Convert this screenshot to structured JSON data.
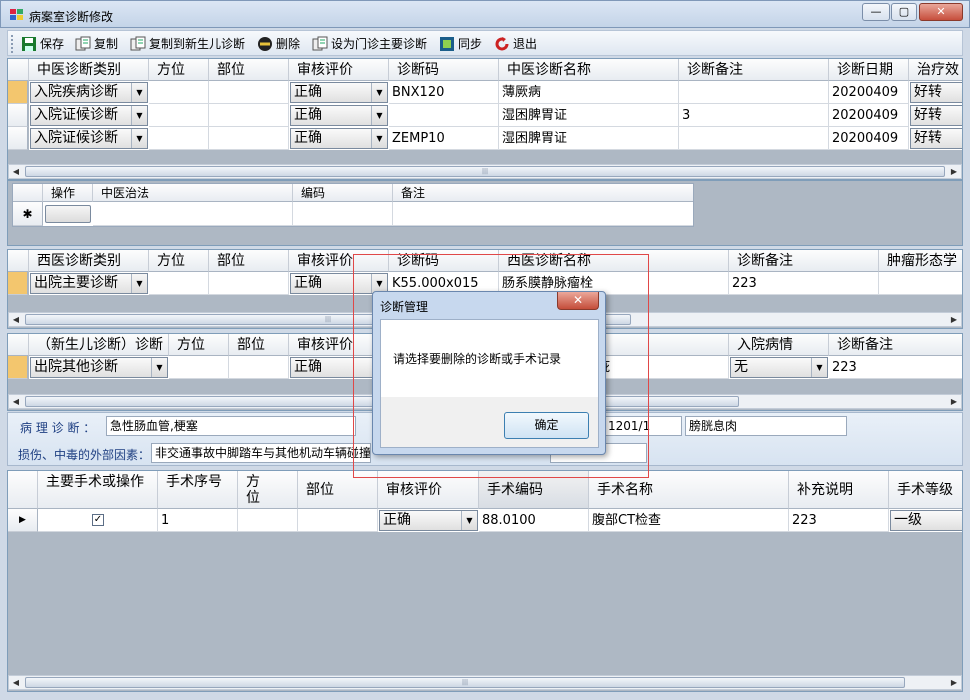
{
  "window": {
    "title": "病案室诊断修改",
    "minimize": "—",
    "restore": "▢",
    "close": "✕"
  },
  "toolbar": {
    "save": "保存",
    "copy": "复制",
    "copy_newborn": "复制到新生儿诊断",
    "delete": "删除",
    "set_main": "设为门诊主要诊断",
    "sync": "同步",
    "exit": "退出"
  },
  "tcm_grid": {
    "headers": [
      "中医诊断类别",
      "方位",
      "部位",
      "审核评价",
      "诊断码",
      "中医诊断名称",
      "诊断备注",
      "诊断日期",
      "治疗效"
    ],
    "rows": [
      {
        "category": "入院疾病诊断",
        "eval": "正确",
        "code": "BNX120",
        "name": "薄厥病",
        "note": "",
        "date": "20200409",
        "effect": "好转"
      },
      {
        "category": "入院证候诊断",
        "eval": "正确",
        "code": "",
        "name": "湿困脾胃证",
        "note": "3",
        "date": "20200409",
        "effect": "好转"
      },
      {
        "category": "入院证候诊断",
        "eval": "正确",
        "code": "ZEMP10",
        "name": "湿困脾胃证",
        "note": "",
        "date": "20200409",
        "effect": "好转"
      }
    ]
  },
  "therapy_grid": {
    "headers": [
      "操作",
      "中医治法",
      "编码",
      "备注"
    ],
    "new_row_marker": "✱"
  },
  "wm_grid": {
    "headers": [
      "西医诊断类别",
      "方位",
      "部位",
      "审核评价",
      "诊断码",
      "西医诊断名称",
      "诊断备注",
      "肿瘤形态学"
    ],
    "rows": [
      {
        "category": "出院主要诊断",
        "eval": "正确",
        "code": "K55.000x015",
        "name": "肠系膜静脉瘤栓",
        "note": "223"
      }
    ]
  },
  "newborn_grid": {
    "headers": [
      "（新生儿诊断）诊断",
      "方位",
      "部位",
      "审核评价",
      "入院病情",
      "诊断备注"
    ],
    "rows": [
      {
        "category": "出院其他诊断",
        "eval": "正确",
        "name_tail": "疵",
        "admission": "无",
        "note": "223"
      }
    ]
  },
  "info": {
    "pathology_label": "病 理 诊 断 ：",
    "pathology_value": "急性肠血管,梗塞",
    "pathology_code": "1201/1",
    "pathology_extra": "膀胱息肉",
    "injury_label": "损伤、中毒的外部因素：",
    "injury_value": "非交通事故中脚踏车与其他机动车辆碰撞"
  },
  "surgery_grid": {
    "headers": [
      "主要手术或操作",
      "手术序号",
      "方位",
      "部位",
      "审核评价",
      "手术编码",
      "手术名称",
      "补充说明",
      "手术等级"
    ],
    "rows": [
      {
        "checked": "✓",
        "seq": "1",
        "eval": "正确",
        "code": "88.0100",
        "name": "腹部CT检查",
        "note": "223",
        "level": "一级"
      }
    ]
  },
  "dialog": {
    "title": "诊断管理",
    "message": "请选择要删除的诊断或手术记录",
    "ok": "确定",
    "close": "✕"
  }
}
